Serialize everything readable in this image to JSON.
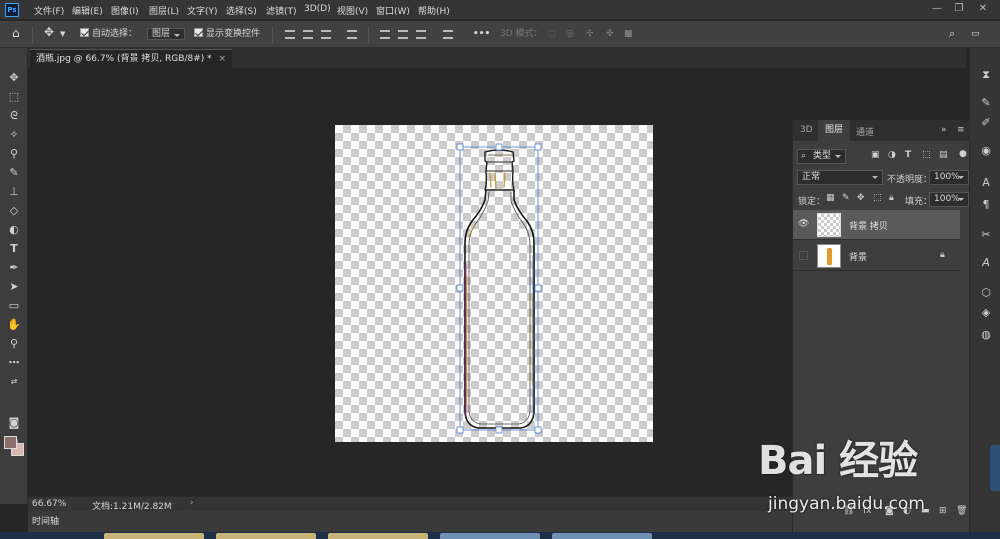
{
  "app": {
    "logo": "Ps"
  },
  "menu": [
    "文件(F)",
    "编辑(E)",
    "图像(I)",
    "图层(L)",
    "文字(Y)",
    "选择(S)",
    "滤镜(T)",
    "3D(D)",
    "视图(V)",
    "窗口(W)",
    "帮助(H)"
  ],
  "window_controls": {
    "minimize": "—",
    "restore": "❐",
    "close": "✕"
  },
  "options": {
    "auto_select_label": "自动选择：",
    "auto_select_value": "图层",
    "show_transform_label": "显示变换控件",
    "more": "•••",
    "mode_3d_label": "3D 模式："
  },
  "document": {
    "tab_title": "酒瓶.jpg @ 66.7% (背景 拷贝, RGB/8#) *",
    "tab_close": "×"
  },
  "status": {
    "zoom": "66.67%",
    "doc_info": "文档:1.21M/2.82M",
    "arrow": "›"
  },
  "timeline": {
    "label": "时间轴"
  },
  "layers_panel": {
    "tabs": [
      "3D",
      "图层",
      "通道"
    ],
    "active_tab": "图层",
    "filter_kind": "类型",
    "blend_mode": "正常",
    "opacity_label": "不透明度：",
    "opacity_value": "100%",
    "lock_label": "锁定：",
    "fill_label": "填充：",
    "fill_value": "100%",
    "layers": [
      {
        "name": "背景 拷贝",
        "visible": true,
        "selected": true,
        "locked": false
      },
      {
        "name": "背景",
        "visible": false,
        "selected": false,
        "locked": true
      }
    ]
  },
  "watermark": {
    "logo": "Bai 经验",
    "url": "jingyan.baidu.com"
  },
  "colors": {
    "accent": "#31a8ff",
    "foreground": "#8b6e6b",
    "background": "#d9b7b3",
    "selection": "#4a7bd8"
  }
}
